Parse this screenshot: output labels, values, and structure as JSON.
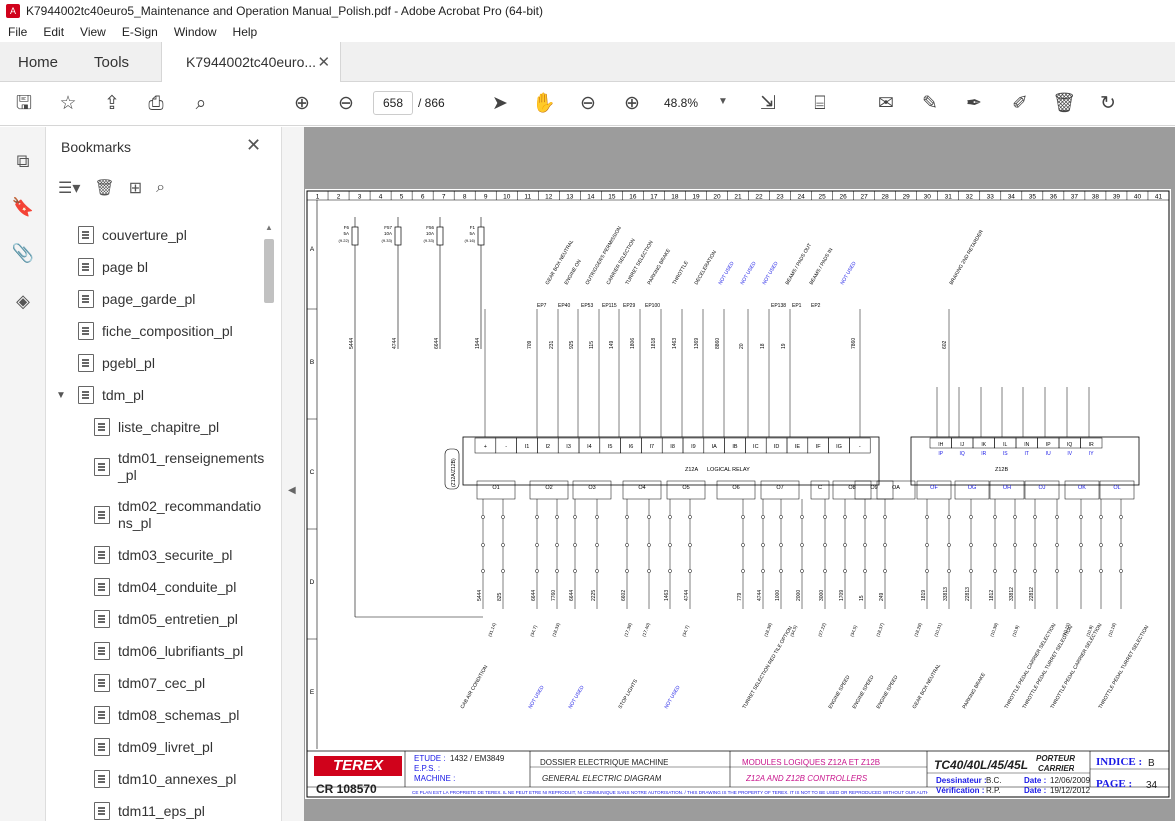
{
  "window": {
    "title": "K7944002tc40euro5_Maintenance and Operation Manual_Polish.pdf - Adobe Acrobat Pro (64-bit)"
  },
  "menu": [
    "File",
    "Edit",
    "View",
    "E-Sign",
    "Window",
    "Help"
  ],
  "tabs": {
    "home": "Home",
    "tools": "Tools",
    "doc": "K7944002tc40euro...",
    "close": "✕"
  },
  "toolbar": {
    "page_current": "658",
    "page_total": "/ 866",
    "zoom": "48.8%"
  },
  "bookmarks": {
    "title": "Bookmarks",
    "items": [
      {
        "label": "couverture_pl"
      },
      {
        "label": "page bl"
      },
      {
        "label": "page_garde_pl"
      },
      {
        "label": "fiche_composition_pl"
      },
      {
        "label": "pgebl_pl"
      },
      {
        "label": "tdm_pl"
      },
      {
        "label": "liste_chapitre_pl"
      },
      {
        "label": "tdm01_renseignements_pl"
      },
      {
        "label": "tdm02_recommandations_pl"
      },
      {
        "label": "tdm03_securite_pl"
      },
      {
        "label": "tdm04_conduite_pl"
      },
      {
        "label": "tdm05_entretien_pl"
      },
      {
        "label": "tdm06_lubrifiants_pl"
      },
      {
        "label": "tdm07_cec_pl"
      },
      {
        "label": "tdm08_schemas_pl"
      },
      {
        "label": "tdm09_livret_pl"
      },
      {
        "label": "tdm10_annexes_pl"
      },
      {
        "label": "tdm11_eps_pl"
      }
    ]
  },
  "diagram": {
    "columns": [
      "1",
      "2",
      "3",
      "4",
      "5",
      "6",
      "7",
      "8",
      "9",
      "10",
      "11",
      "12",
      "13",
      "14",
      "15",
      "16",
      "17",
      "18",
      "19",
      "20",
      "21",
      "22",
      "23",
      "24",
      "25",
      "26",
      "27",
      "28",
      "29",
      "30",
      "31",
      "32",
      "33",
      "34",
      "35",
      "36",
      "37",
      "38",
      "39",
      "40",
      "41"
    ],
    "rows": [
      "A",
      "B",
      "C",
      "D",
      "E"
    ],
    "fuses": [
      {
        "id": "F6",
        "amp": "5A",
        "ref": "(9.22)"
      },
      {
        "id": "F57",
        "amp": "10A",
        "ref": "(9.33)"
      },
      {
        "id": "F56",
        "amp": "10A",
        "ref": "(9.33)"
      },
      {
        "id": "F1",
        "amp": "5A",
        "ref": "(9.16)"
      }
    ],
    "top_labels": [
      {
        "text": "GEAR BOX NEUTRAL",
        "unused": false
      },
      {
        "text": "ENGINE ON",
        "unused": false
      },
      {
        "text": "OUTRIGGERS PERMISSION",
        "unused": false
      },
      {
        "text": "CARRIER SELECTION",
        "unused": false
      },
      {
        "text": "TURRET SELECTION",
        "unused": false
      },
      {
        "text": "PARKING BRAKE",
        "unused": false
      },
      {
        "text": "THROTTLE",
        "unused": false
      },
      {
        "text": "DECELERATION",
        "unused": false
      },
      {
        "text": "NOT USED",
        "unused": true
      },
      {
        "text": "NOT USED",
        "unused": true
      },
      {
        "text": "NOT USED",
        "unused": true
      },
      {
        "text": "BEAMS / PADS OUT",
        "unused": false
      },
      {
        "text": "BEAMS / PADS IN",
        "unused": false
      },
      {
        "text": "NOT USED",
        "unused": true
      },
      {
        "text": "BRAKING 2ND RETARDER",
        "unused": false
      }
    ],
    "top_inputs": [
      "EP7",
      "EP40",
      "EP53",
      "EP115",
      "EP29",
      "EP100",
      "EP138",
      "EP1",
      "EP2"
    ],
    "wires_top": [
      "5444",
      "4744",
      "6644",
      "1944",
      "709",
      "231",
      "925",
      "115",
      "149",
      "1806",
      "1818",
      "1463",
      "1369",
      "8860",
      "20",
      "18",
      "19",
      "7860",
      "602"
    ],
    "relay_top_cells": [
      "+",
      "-",
      "I1",
      "I2",
      "I3",
      "I4",
      "I5",
      "I6",
      "I7",
      "I8",
      "I9",
      "IA",
      "IB",
      "IC",
      "ID",
      "IE",
      "IF",
      "IG",
      "-"
    ],
    "relay_right_cells": [
      "IH",
      "IJ",
      "IK",
      "IL",
      "IN",
      "IP",
      "IQ",
      "IR"
    ],
    "relay_right_cells2": [
      "IP",
      "IQ",
      "IR",
      "IS",
      "IT",
      "IU",
      "IV",
      "IY"
    ],
    "relay_label_a": "Z12A",
    "relay_label": "LOGICAL RELAY",
    "relay_label_b": "Z12B",
    "side_label": "(Z12A/Z12B)",
    "output_groups": [
      "O1",
      "O2",
      "O3",
      "O4",
      "O5",
      "O6",
      "O7",
      "C",
      "O8",
      "O9",
      "OA"
    ],
    "output_groups_b": [
      "OF",
      "OG",
      "OH",
      "OJ",
      "OK",
      "OL"
    ],
    "bottom_labels": [
      {
        "text": "CAB AIR CONDITION",
        "unused": false
      },
      {
        "text": "NOT USED",
        "unused": true
      },
      {
        "text": "NOT USED",
        "unused": true
      },
      {
        "text": "STOP LIGHTS",
        "unused": false
      },
      {
        "text": "NOT USED",
        "unused": true
      },
      {
        "text": "TURRET SELECTION RED TILE OPTION",
        "unused": false
      },
      {
        "text": "ENGINE SPEED",
        "unused": false
      },
      {
        "text": "ENGINE SPEED",
        "unused": false
      },
      {
        "text": "ENGINE SPEED",
        "unused": false
      },
      {
        "text": "GEAR BOX NEUTRAL",
        "unused": false
      },
      {
        "text": "PARKING BRAKE",
        "unused": false
      },
      {
        "text": "THROTTLE PEDAL CARRIER SELECTION",
        "unused": false
      },
      {
        "text": "THROTTLE PEDAL TURRET SELECTION",
        "unused": false
      },
      {
        "text": "THROTTLE PEDAL CARRIER SELECTION",
        "unused": false
      },
      {
        "text": "THROTTLE PEDAL TURRET SELECTION",
        "unused": false
      }
    ],
    "wires_bottom": [
      "5444",
      "825",
      "6644",
      "7760",
      "6644",
      "2225",
      "6602",
      "1463",
      "4744",
      "779",
      "4744",
      "1000",
      "2000",
      "3000",
      "1709",
      "15",
      "249",
      "1819",
      "33813",
      "22813",
      "1812",
      "33812",
      "22812"
    ],
    "bottom_refs": [
      "(31.14)",
      "(34.7)",
      "(18.33)",
      "(17.38)",
      "(17.40)",
      "(34.7)",
      "(18.38)",
      "(34.5)",
      "(27.22)",
      "(34.5)",
      "(18.37)",
      "(18.28)",
      "(10.31)",
      "(10.39)",
      "(10.9)",
      "(10.15)",
      "(10.9)",
      "(10.18)"
    ]
  },
  "titleblock": {
    "brand": "TEREX",
    "cr": "CR 108570",
    "etude_label": "ETUDE :",
    "etude_value": "1432 / EM3849",
    "eps_label": "E.P.S. :",
    "machine_label": "MACHINE :",
    "dossier": "DOSSIER ELECTRIQUE MACHINE",
    "general": "GENERAL ELECTRIC DIAGRAM",
    "modules_fr": "MODULES LOGIQUES Z12A ET Z12B",
    "modules_en": "Z12A AND Z12B CONTROLLERS",
    "model": "TC40/40L/45/45L",
    "porteur": "PORTEUR",
    "carrier": "CARRIER",
    "dessinateur_label": "Dessinateur :",
    "dessinateur": "B.C.",
    "date_label": "Date :",
    "date1": "12/06/2009",
    "verif_label": "Vérification :",
    "verif": "R.P.",
    "date2": "19/12/2012",
    "indice_label": "INDICE :",
    "indice": "B",
    "page_label": "PAGE :",
    "page": "34",
    "legal": "CE PLAN EST LA PROPRIETE DE TEREX. IL NE PEUT ETRE NI REPRODUIT, NI COMMUNIQUE SANS NOTRE AUTORISATION. / THIS DRAWING IS THE PROPERTY OF TEREX. IT IS NOT TO BE USED OR REPRODUCED WITHOUT OUR AUTHORISATION."
  },
  "colors": {
    "unused": "#1a1ae6",
    "brand_red": "#d0021b",
    "accent": "#1473e6",
    "magenta": "#c8148c"
  }
}
